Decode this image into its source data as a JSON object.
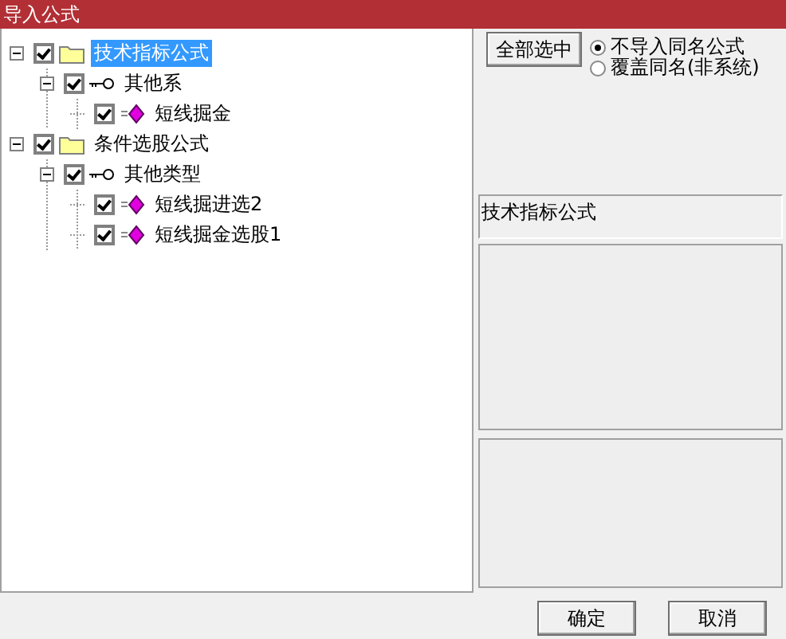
{
  "window": {
    "title": "导入公式"
  },
  "tree": [
    {
      "label": "技术指标公式",
      "kind": "category",
      "checked": true,
      "expanded": true,
      "selected": true,
      "children": [
        {
          "label": "其他系",
          "kind": "group",
          "checked": true,
          "expanded": true,
          "selected": false,
          "children": [
            {
              "label": "短线掘金",
              "kind": "formula",
              "checked": true,
              "selected": false
            }
          ]
        }
      ]
    },
    {
      "label": "条件选股公式",
      "kind": "category",
      "checked": true,
      "expanded": true,
      "selected": false,
      "children": [
        {
          "label": "其他类型",
          "kind": "group",
          "checked": true,
          "expanded": true,
          "selected": false,
          "children": [
            {
              "label": "短线掘进选2",
              "kind": "formula",
              "checked": true,
              "selected": false
            },
            {
              "label": "短线掘金选股1",
              "kind": "formula",
              "checked": true,
              "selected": false
            }
          ]
        }
      ]
    }
  ],
  "select_all_button": "全部选中",
  "options": [
    {
      "label": "不导入同名公式",
      "selected": true
    },
    {
      "label": "覆盖同名(非系统)",
      "selected": false
    }
  ],
  "info_label": "技术指标公式",
  "buttons": [
    "确定",
    "取消"
  ]
}
